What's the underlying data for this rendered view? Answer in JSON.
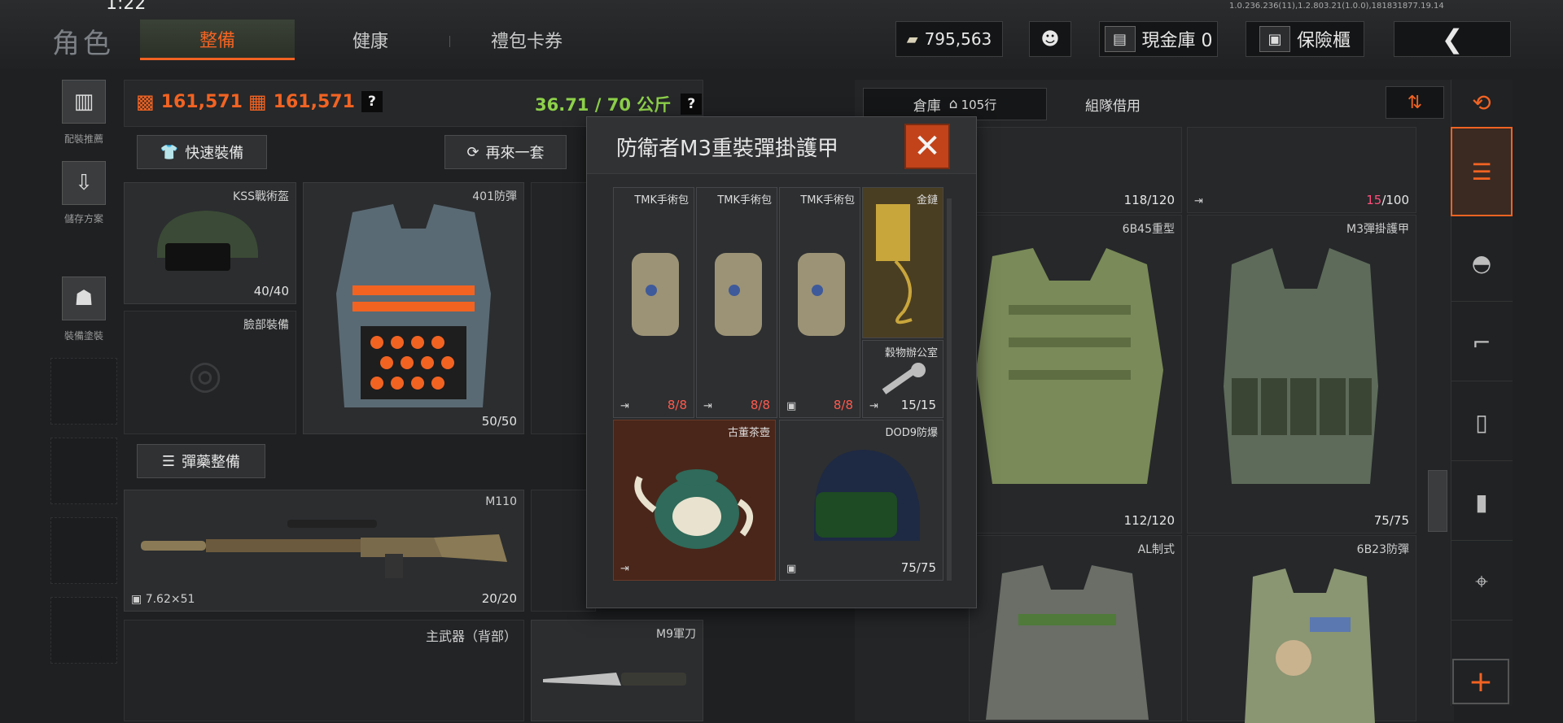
{
  "status": {
    "time": "1:22",
    "version": "1.0.236.236(11),1.2.803.21(1.0.0),181831877.19.14"
  },
  "page_title": "角色",
  "tabs": [
    {
      "label": "整備"
    },
    {
      "label": "健康"
    },
    {
      "label": "禮包卡券"
    }
  ],
  "top_bar": {
    "money": "795,563",
    "cash_vault": "現金庫 0",
    "safe_box": "保險櫃"
  },
  "left_rail": [
    {
      "label": "配裝推薦"
    },
    {
      "label": "儲存方案"
    },
    {
      "label": "裝備塗裝"
    }
  ],
  "stats": {
    "value1": "161,571",
    "value2": "161,571",
    "weight": "36.71 / 70 公斤",
    "help": "?"
  },
  "buttons": {
    "quick_equip": "快速裝備",
    "again": "再來一套",
    "ammo": "彈藥整備"
  },
  "equip_slots": {
    "helmet": {
      "name": "KSS戰術盔",
      "qty": "40/40"
    },
    "armor": {
      "name": "401防彈",
      "qty": "50/50"
    },
    "face": {
      "name": "臉部裝備"
    },
    "primary": {
      "name": "M110",
      "caliber": "7.62×51",
      "qty": "20/20"
    },
    "primary_back": {
      "name": "主武器（背部）"
    },
    "melee": {
      "name": "M9軍刀"
    }
  },
  "modal": {
    "title": "防衛者M3重裝彈掛護甲",
    "close": "✕",
    "items": [
      {
        "name": "TMK手術包",
        "qty": "8/8"
      },
      {
        "name": "TMK手術包",
        "qty": "8/8"
      },
      {
        "name": "TMK手術包",
        "qty": "8/8"
      },
      {
        "name": "金鏈",
        "qty": ""
      },
      {
        "name": "穀物辦公室",
        "qty": "15/15"
      },
      {
        "name": "古董茶壺",
        "qty": ""
      },
      {
        "name": "DOD9防爆",
        "qty": "75/75"
      }
    ]
  },
  "warehouse": {
    "tab_storage": "倉庫",
    "rows": "105行",
    "tab_team": "組隊借用",
    "items": [
      {
        "name": "",
        "qty": "118/120"
      },
      {
        "name": "",
        "qty": "15",
        "qty_max": "/100"
      },
      {
        "name": "6B45重型",
        "qty": "112/120"
      },
      {
        "name": "M3彈掛護甲",
        "qty": "75/75"
      },
      {
        "name": "AL制式",
        "qty": ""
      },
      {
        "name": "6B23防彈",
        "qty": ""
      }
    ]
  },
  "icons": {
    "close": "close-icon",
    "back": "chevron-left-icon"
  },
  "colors": {
    "accent": "#f26322",
    "weight_ok": "#8ed14a",
    "qty_low": "#ff5a4e"
  }
}
